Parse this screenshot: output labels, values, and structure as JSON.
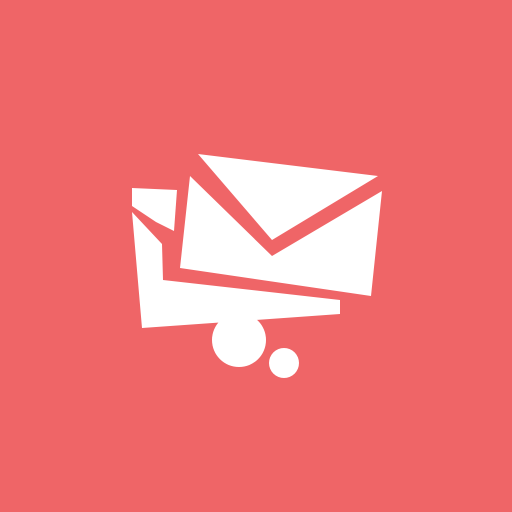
{
  "icon": {
    "name": "mail-envelopes-icon",
    "background_color": "#EF6567",
    "foreground_color": "#FFFFFF"
  }
}
